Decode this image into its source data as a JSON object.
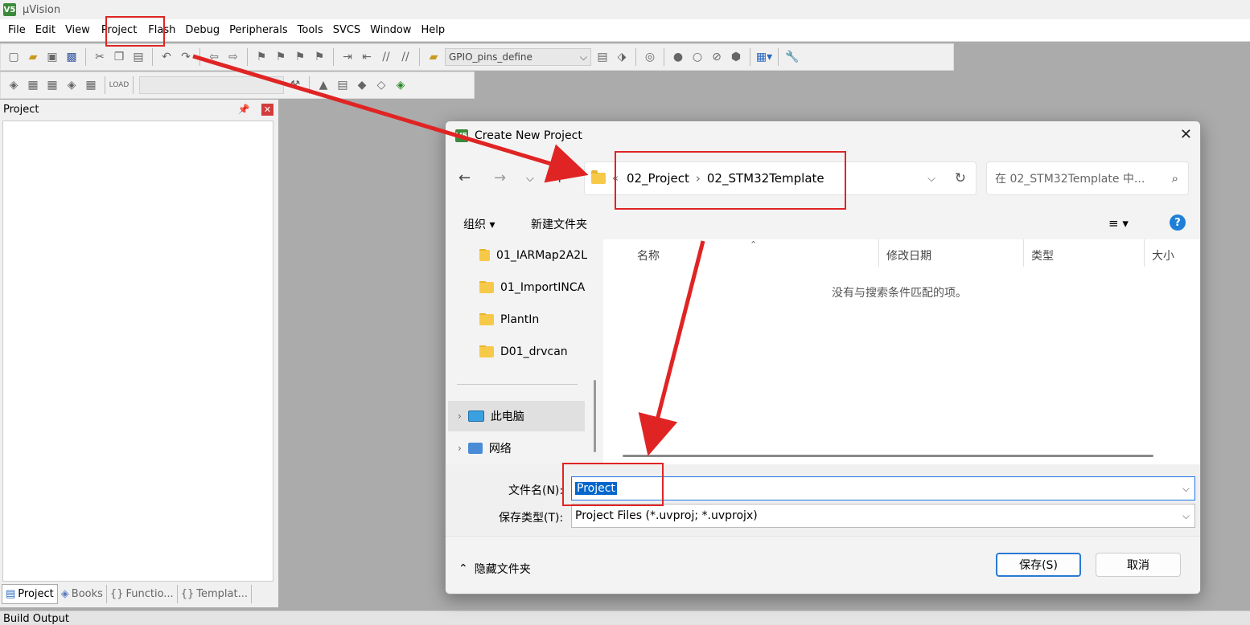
{
  "app": {
    "title": "µVision",
    "logo": "V5"
  },
  "menu": [
    "File",
    "Edit",
    "View",
    "Project",
    "Flash",
    "Debug",
    "Peripherals",
    "Tools",
    "SVCS",
    "Window",
    "Help"
  ],
  "toolbar": {
    "target_combo": "GPIO_pins_define"
  },
  "project_panel": {
    "title": "Project",
    "tabs": [
      "Project",
      "Books",
      "Functio...",
      "Templat..."
    ]
  },
  "build_output": "Build Output",
  "dialog": {
    "title": "Create New Project",
    "breadcrumb_prefix": "«",
    "breadcrumb": [
      "02_Project",
      "02_STM32Template"
    ],
    "search_placeholder": "在 02_STM32Template 中...",
    "organize": "组织 ▾",
    "new_folder": "新建文件夹",
    "view_icon": "≡ ▾",
    "tree": [
      "01_IARMap2A2L",
      "01_ImportINCA",
      "PlantIn",
      "D01_drvcan"
    ],
    "tree_nodes": [
      "此电脑",
      "网络"
    ],
    "columns": [
      "名称",
      "修改日期",
      "类型",
      "大小"
    ],
    "empty_message": "没有与搜索条件匹配的项。",
    "filename_label": "文件名(N):",
    "filename_value": "Project",
    "filetype_label": "保存类型(T):",
    "filetype_value": "Project Files (*.uvproj; *.uvprojx)",
    "hide_folders": "隐藏文件夹",
    "save_button": "保存(S)",
    "cancel_button": "取消"
  },
  "colors": {
    "annotation": "#e02424",
    "accent": "#0066cc",
    "folder": "#f7c948"
  }
}
